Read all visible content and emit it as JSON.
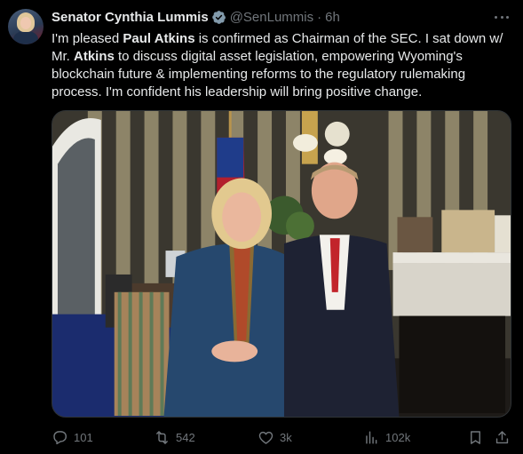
{
  "tweet": {
    "author_name": "Senator Cynthia Lummis",
    "handle": "@SenLummis",
    "separator": "·",
    "time": "6h",
    "text": {
      "p1": "I'm pleased ",
      "b1": "Paul Atkins",
      "p2": " is confirmed as Chairman of the SEC. I sat down w/ Mr. ",
      "b2": "Atkins",
      "p3": " to discuss digital asset legislation, empowering Wyoming's blockchain future & implementing reforms to the regulatory rulemaking process. I'm confident his leadership will bring positive change."
    },
    "icons": {
      "verified": "verified-badge-icon",
      "more": "more-icon",
      "reply": "reply-icon",
      "retweet": "retweet-icon",
      "like": "like-icon",
      "views": "views-icon",
      "bookmark": "bookmark-icon",
      "share": "share-icon"
    },
    "stats": {
      "replies": "101",
      "retweets": "542",
      "likes": "3k",
      "views": "102k"
    },
    "colors": {
      "background": "#000000",
      "text": "#e7e9ea",
      "muted": "#71767b",
      "verified": "#829aab"
    }
  }
}
